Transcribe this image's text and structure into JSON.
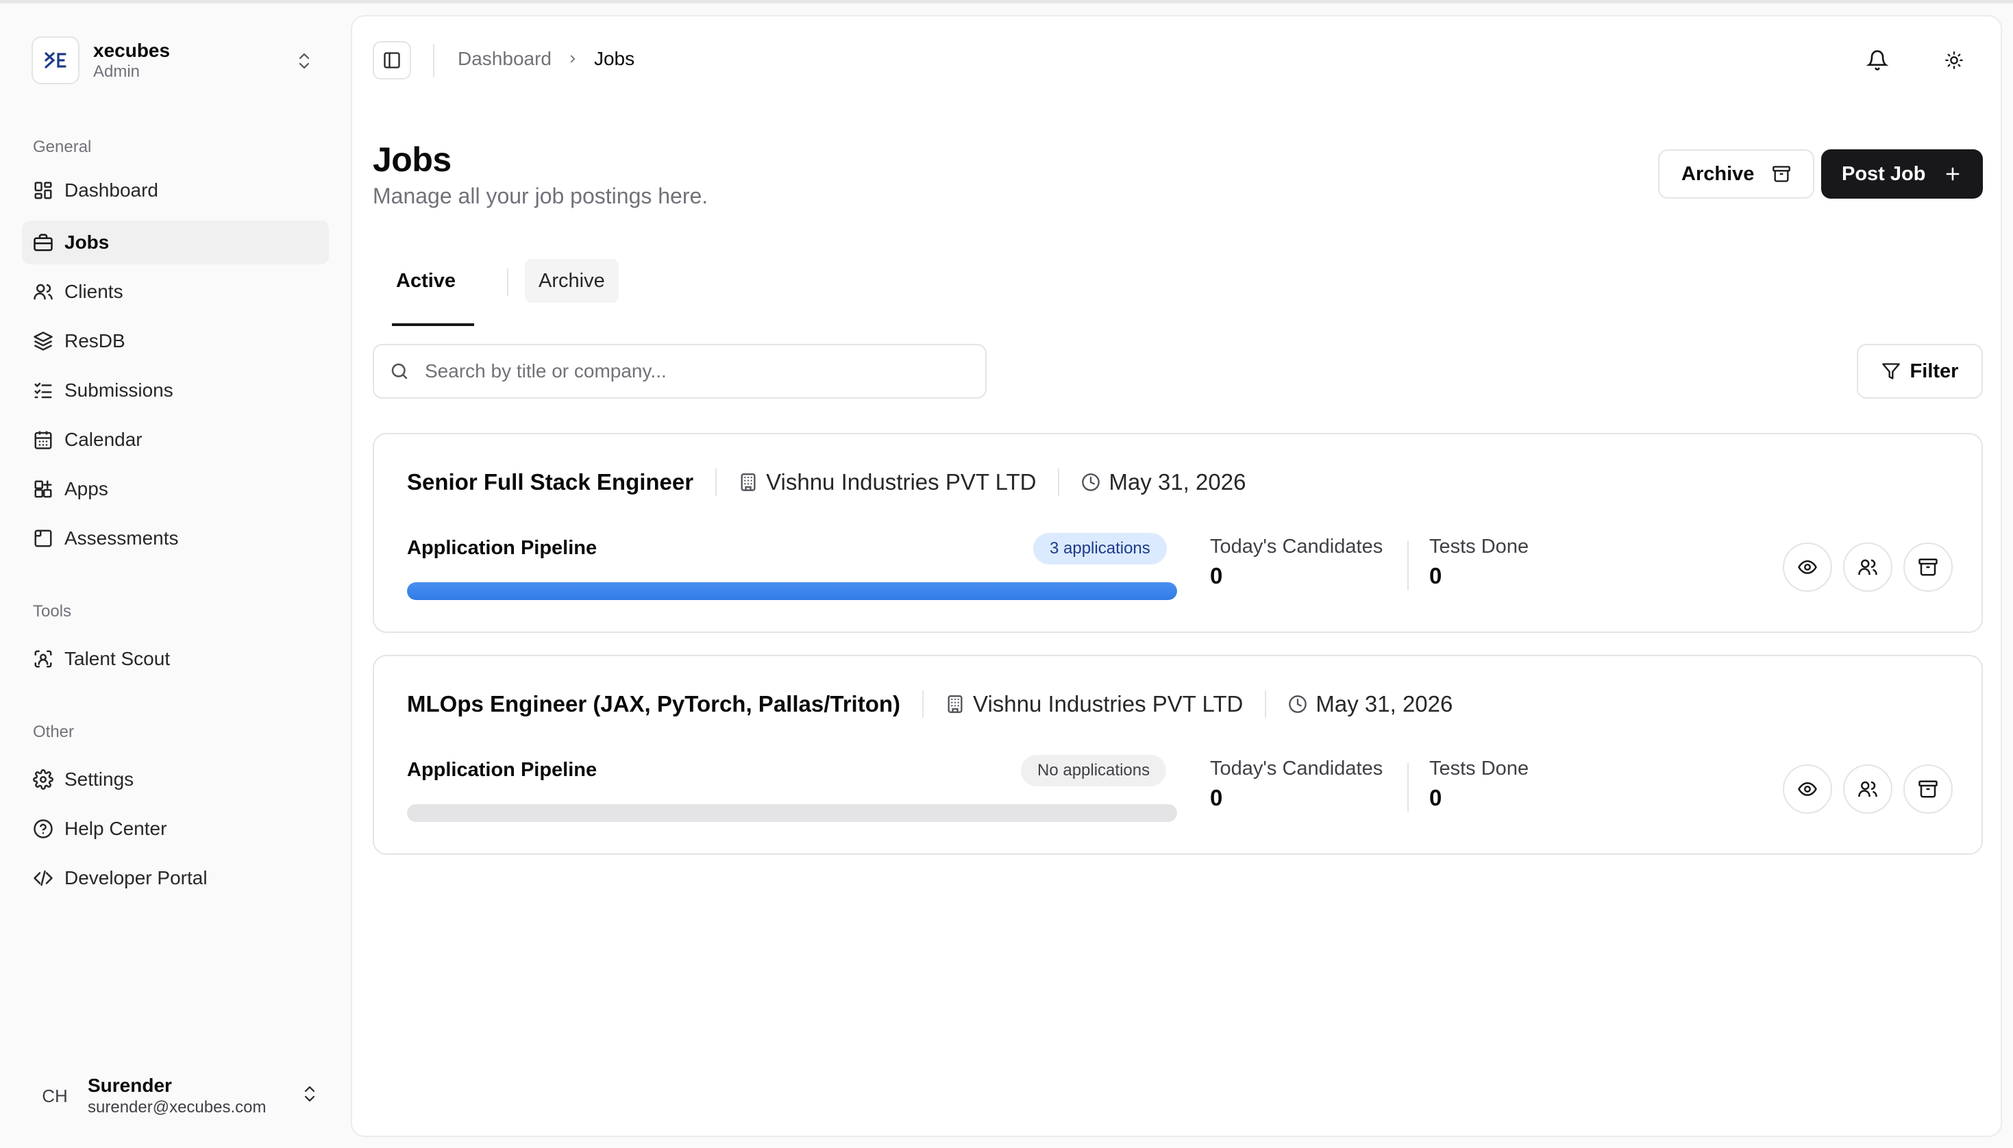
{
  "workspace": {
    "initials": "XE",
    "name": "xecubes",
    "role": "Admin"
  },
  "sidebar": {
    "groups": [
      {
        "label": "General",
        "items": [
          {
            "label": "Dashboard",
            "icon": "dashboard-icon"
          },
          {
            "label": "Jobs",
            "icon": "briefcase-icon",
            "active": true
          },
          {
            "label": "Clients",
            "icon": "users-icon"
          },
          {
            "label": "ResDB",
            "icon": "layers-icon"
          },
          {
            "label": "Submissions",
            "icon": "list-checks-icon"
          },
          {
            "label": "Calendar",
            "icon": "calendar-icon"
          },
          {
            "label": "Apps",
            "icon": "apps-plus-icon"
          },
          {
            "label": "Assessments",
            "icon": "clipboard-icon"
          }
        ]
      },
      {
        "label": "Tools",
        "items": [
          {
            "label": "Talent Scout",
            "icon": "scan-user-icon"
          }
        ]
      },
      {
        "label": "Other",
        "items": [
          {
            "label": "Settings",
            "icon": "gear-icon"
          },
          {
            "label": "Help Center",
            "icon": "help-circle-icon"
          },
          {
            "label": "Developer Portal",
            "icon": "code-icon"
          }
        ]
      }
    ]
  },
  "user": {
    "initials": "CH",
    "name": "Surender",
    "email": "surender@xecubes.com"
  },
  "header": {
    "breadcrumb": [
      "Dashboard",
      "Jobs"
    ]
  },
  "page": {
    "title": "Jobs",
    "subtitle": "Manage all your job postings here.",
    "archive_button": "Archive",
    "post_button": "Post Job",
    "tabs": [
      "Active",
      "Archive"
    ],
    "search_placeholder": "Search by title or company...",
    "filter_button": "Filter"
  },
  "jobs": [
    {
      "title": "Senior Full Stack Engineer",
      "company": "Vishnu Industries PVT LTD",
      "date": "May 31, 2026",
      "pipeline_label": "Application Pipeline",
      "badge": "3 applications",
      "pipeline_fill": 1.0,
      "todays_label": "Today's Candidates",
      "todays_value": "0",
      "tests_label": "Tests Done",
      "tests_value": "0"
    },
    {
      "title": "MLOps Engineer (JAX, PyTorch, Pallas/Triton)",
      "company": "Vishnu Industries PVT LTD",
      "date": "May 31, 2026",
      "pipeline_label": "Application Pipeline",
      "badge": "No applications",
      "pipeline_fill": 0,
      "todays_label": "Today's Candidates",
      "todays_value": "0",
      "tests_label": "Tests Done",
      "tests_value": "0"
    }
  ],
  "colors": {
    "accent_bar": "#3b82f6",
    "badge_blue_bg": "#dbeafe",
    "primary_button": "#18181b"
  }
}
